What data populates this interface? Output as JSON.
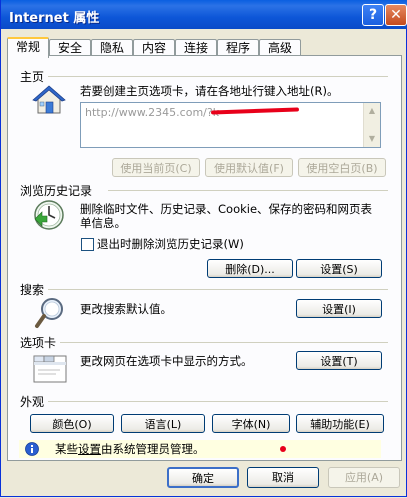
{
  "window": {
    "title": "Internet 属性",
    "help_icon": "?",
    "close_icon": "✕"
  },
  "tabs": [
    "常规",
    "安全",
    "隐私",
    "内容",
    "连接",
    "程序",
    "高级"
  ],
  "active_tab": 0,
  "home": {
    "title": "主页",
    "instruction": "若要创建主页选项卡，请在各地址行键入地址(R)。",
    "url": "http://www.2345.com/?k",
    "buttons": {
      "use_current": "使用当前页(C)",
      "use_default": "使用默认值(F)",
      "use_blank": "使用空白页(B)"
    }
  },
  "history": {
    "title": "浏览历史记录",
    "description": "删除临时文件、历史记录、Cookie、保存的密码和网页表单信息。",
    "checkbox_label": "退出时删除浏览历史记录(W)",
    "checkbox_checked": false,
    "delete_button": "删除(D)...",
    "settings_button": "设置(S)"
  },
  "search": {
    "title": "搜索",
    "description": "更改搜索默认值。",
    "settings_button": "设置(I)"
  },
  "tabs_section": {
    "title": "选项卡",
    "description": "更改网页在选项卡中显示的方式。",
    "settings_button": "设置(T)"
  },
  "appearance": {
    "title": "外观",
    "colors": "颜色(O)",
    "languages": "语言(L)",
    "fonts": "字体(N)",
    "accessibility": "辅助功能(E)"
  },
  "info": {
    "prefix": "某些",
    "link": "设置",
    "suffix": "由系统管理员管理。"
  },
  "dialog_buttons": {
    "ok": "确定",
    "cancel": "取消",
    "apply": "应用(A)"
  },
  "colors": {
    "titlebar": "#0a5fe0",
    "tab_highlight": "#ffc83c",
    "info_bg": "#ffffe1",
    "panel_bg": "#fcfcfe"
  }
}
